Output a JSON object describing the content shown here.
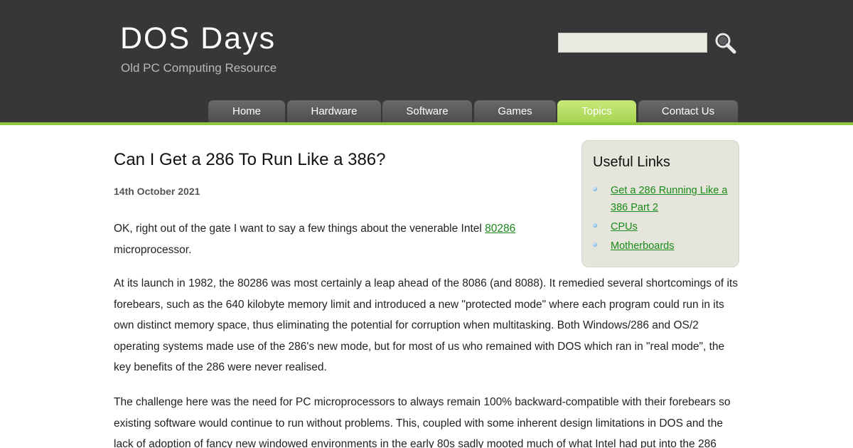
{
  "site": {
    "title": "DOS Days",
    "tagline": "Old PC Computing Resource"
  },
  "search": {
    "value": "",
    "placeholder": "",
    "icon": "search-icon"
  },
  "nav": {
    "tabs": [
      {
        "label": "Home",
        "active": false
      },
      {
        "label": "Hardware",
        "active": false
      },
      {
        "label": "Software",
        "active": false
      },
      {
        "label": "Games",
        "active": false
      },
      {
        "label": "Topics",
        "active": true
      },
      {
        "label": "Contact Us",
        "active": false
      }
    ]
  },
  "article": {
    "title": "Can I Get a 286 To Run Like a 386?",
    "date": "14th October 2021",
    "p1_before": "OK, right out of the gate I want to say a few things about the venerable Intel ",
    "p1_link": "80286",
    "p1_after": " microprocessor.",
    "p2": "At its launch in 1982, the 80286 was most certainly a leap ahead of the 8086 (and 8088). It remedied several shortcomings of its forebears, such as the 640 kilobyte memory limit and introduced a new \"protected mode\" where each program could run in its own distinct memory space, thus eliminating the potential for corruption when multitasking. Both Windows/286 and OS/2 operating systems made use of the 286's new mode, but for most of us who remained with DOS which ran in \"real mode\", the key benefits of the 286 were never realised.",
    "p3": "The challenge here was the need for PC microprocessors to always remain 100% backward-compatible with their forebears so existing software would continue to run without problems. This, coupled with some inherent design limitations in DOS and the lack of adoption of fancy new windowed environments in the early 80s sadly mooted much of what Intel had put into the 286"
  },
  "sidebar": {
    "title": "Useful Links",
    "links": [
      {
        "label": "Get a 286 Running Like a 386 Part 2"
      },
      {
        "label": "CPUs"
      },
      {
        "label": "Motherboards"
      }
    ]
  },
  "colors": {
    "header_bg": "#373737",
    "accent_green": "#8dc63f",
    "link_green": "#1a8a1a",
    "tab_gray": "#5a5a5a",
    "sidebar_bg": "#e5e5dc"
  }
}
